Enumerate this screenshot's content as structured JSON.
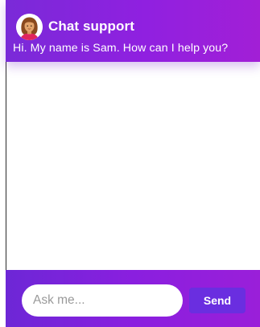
{
  "header": {
    "title": "Chat support",
    "greeting": "Hi. My name is Sam. How can I help you?",
    "avatar_icon": "agent-avatar-icon"
  },
  "composer": {
    "placeholder": "Ask me...",
    "value": "",
    "send_label": "Send"
  },
  "colors": {
    "header_start": "#7a2ad8",
    "header_end": "#a21fd6",
    "footer_start": "#6d27d6",
    "footer_end": "#9a1fd9",
    "send_button": "#6a2ee0"
  }
}
